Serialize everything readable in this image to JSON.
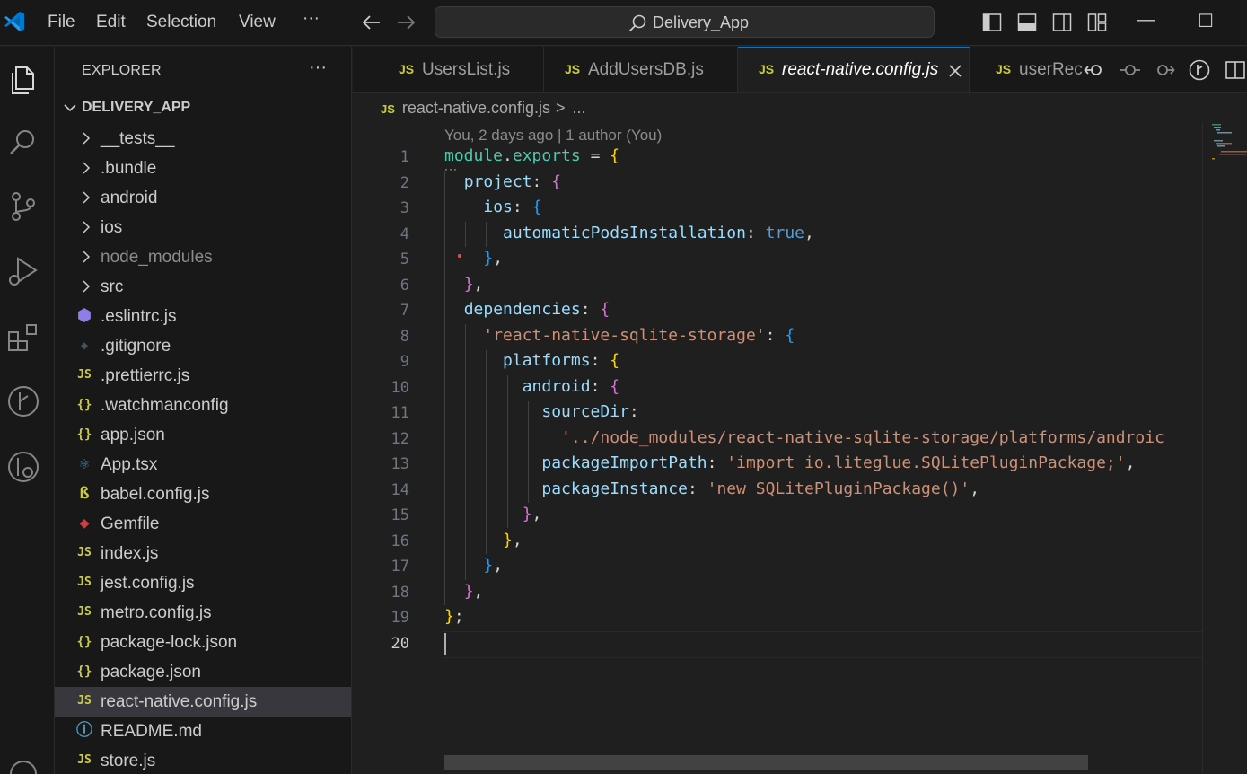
{
  "titlebar": {
    "menu": [
      "File",
      "Edit",
      "Selection",
      "View"
    ],
    "more": "···",
    "search_text": "Delivery_App",
    "minimize": "—",
    "maximize": "☐"
  },
  "explorer": {
    "title": "EXPLORER",
    "more": "···",
    "root": "DELIVERY_APP",
    "items": [
      {
        "name": "__tests__",
        "type": "folder"
      },
      {
        "name": ".bundle",
        "type": "folder"
      },
      {
        "name": "android",
        "type": "folder"
      },
      {
        "name": "ios",
        "type": "folder"
      },
      {
        "name": "node_modules",
        "type": "folder",
        "dim": true
      },
      {
        "name": "src",
        "type": "folder"
      },
      {
        "name": ".eslintrc.js",
        "type": "eslint"
      },
      {
        "name": ".gitignore",
        "type": "git"
      },
      {
        "name": ".prettierrc.js",
        "type": "js"
      },
      {
        "name": ".watchmanconfig",
        "type": "json"
      },
      {
        "name": "app.json",
        "type": "json"
      },
      {
        "name": "App.tsx",
        "type": "react"
      },
      {
        "name": "babel.config.js",
        "type": "babel"
      },
      {
        "name": "Gemfile",
        "type": "ruby"
      },
      {
        "name": "index.js",
        "type": "js"
      },
      {
        "name": "jest.config.js",
        "type": "js"
      },
      {
        "name": "metro.config.js",
        "type": "js"
      },
      {
        "name": "package-lock.json",
        "type": "json"
      },
      {
        "name": "package.json",
        "type": "json"
      },
      {
        "name": "react-native.config.js",
        "type": "js",
        "selected": true
      },
      {
        "name": "README.md",
        "type": "info"
      },
      {
        "name": "store.js",
        "type": "js"
      }
    ]
  },
  "tabs": [
    {
      "label": "UsersList.js",
      "active": false
    },
    {
      "label": "AddUsersDB.js",
      "active": false
    },
    {
      "label": "react-native.config.js",
      "active": true
    },
    {
      "label": "userRec",
      "active": false
    }
  ],
  "js_badge": "JS",
  "breadcrumb": {
    "file": "react-native.config.js",
    "sep": ">",
    "more": "..."
  },
  "editor": {
    "blame": "You, 2 days ago | 1 author (You)",
    "line_numbers": [
      "1",
      "2",
      "3",
      "4",
      "5",
      "6",
      "7",
      "8",
      "9",
      "10",
      "11",
      "12",
      "13",
      "14",
      "15",
      "16",
      "17",
      "18",
      "19",
      "20"
    ],
    "current_line": 20
  },
  "colors": {
    "accent": "#0078d4",
    "string": "#ce9178",
    "property": "#9cdcfe",
    "keyword": "#569cd6",
    "bracket_gold": "#ffd700",
    "bracket_orchid": "#da70d6",
    "bracket_blue": "#179fff"
  }
}
